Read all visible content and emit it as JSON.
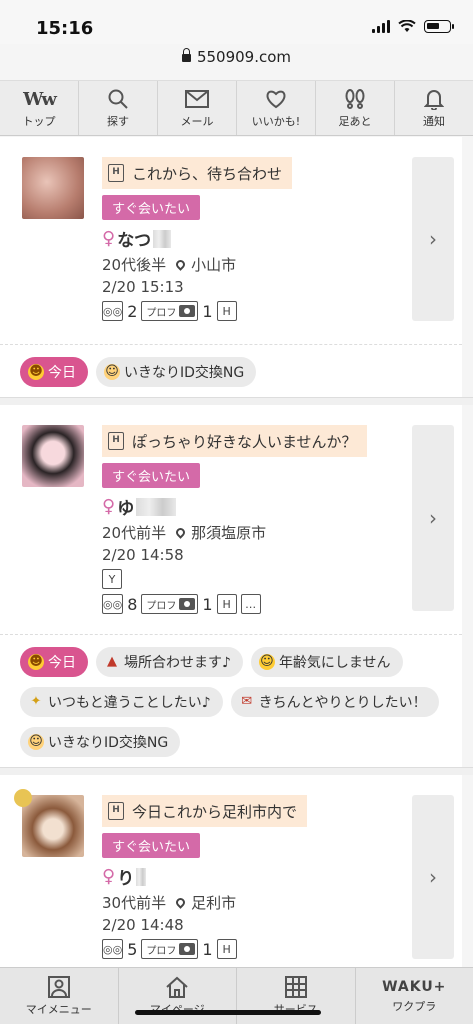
{
  "status_bar": {
    "time": "15:16"
  },
  "browser": {
    "url": "550909.com"
  },
  "top_nav": {
    "items": [
      {
        "label": "トップ",
        "icon": "ww-logo-icon"
      },
      {
        "label": "探す",
        "icon": "search-icon"
      },
      {
        "label": "メール",
        "icon": "mail-icon"
      },
      {
        "label": "いいかも!",
        "icon": "heart-icon"
      },
      {
        "label": "足あと",
        "icon": "footprint-icon"
      },
      {
        "label": "通知",
        "icon": "bell-icon"
      }
    ],
    "logo_text": "Ww"
  },
  "posts": [
    {
      "title": "これから、待ち合わせ",
      "badge": "すぐ会いたい",
      "name": "なつ",
      "age": "20代後半",
      "location": "小山市",
      "datetime": "2/20 15:13",
      "views": "2",
      "photos": "1",
      "prof_label": "プロフ",
      "tags": [
        "今日",
        "いきなりID交換NG"
      ]
    },
    {
      "title": "ぽっちゃり好きな人いませんか？",
      "badge": "すぐ会いたい",
      "name": "ゆ",
      "age": "20代前半",
      "location": "那須塩原市",
      "datetime": "2/20 14:58",
      "views": "8",
      "photos": "1",
      "prof_label": "プロフ",
      "tags": [
        "今日",
        "場所合わせます♪",
        "年齢気にしません",
        "いつもと違うことしたい♪",
        "きちんとやりとりしたい！",
        "いきなりID交換NG"
      ]
    },
    {
      "title": "今日これから足利市内で",
      "badge": "すぐ会いたい",
      "name": "り",
      "age": "30代前半",
      "location": "足利市",
      "datetime": "2/20 14:48",
      "views": "5",
      "photos": "1",
      "prof_label": "プロフ",
      "tags": []
    }
  ],
  "bottom_nav": {
    "items": [
      {
        "label": "マイメニュー",
        "icon": "profile-icon"
      },
      {
        "label": "マイページ",
        "icon": "home-icon"
      },
      {
        "label": "サービス",
        "icon": "grid-icon"
      },
      {
        "label": "ワクプラ",
        "icon": "waku-plus-icon",
        "logo": "WAKU+"
      }
    ]
  },
  "colors": {
    "accent_pink": "#d46aa8",
    "title_bg": "#fde9d6",
    "today_tag": "#d9558f"
  }
}
